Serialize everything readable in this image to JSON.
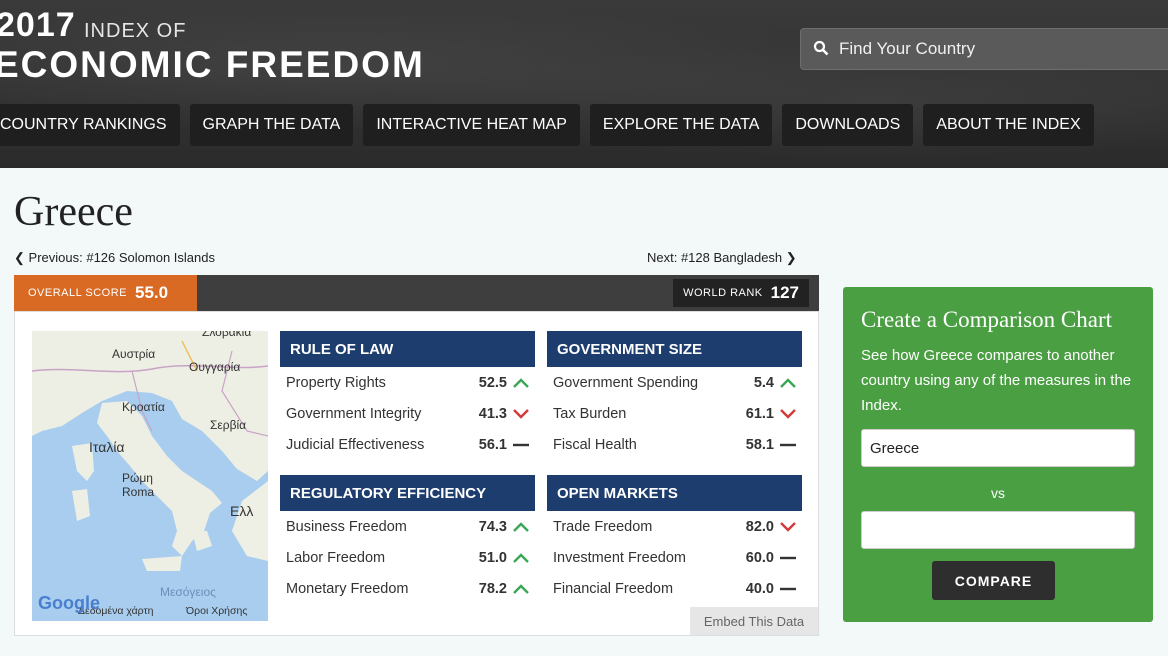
{
  "header": {
    "year": "2017",
    "index_of": "INDEX OF",
    "title": "ECONOMIC FREEDOM",
    "search_placeholder": "Find Your Country"
  },
  "nav": [
    {
      "label": "COUNTRY RANKINGS"
    },
    {
      "label": "GRAPH THE DATA"
    },
    {
      "label": "INTERACTIVE HEAT MAP"
    },
    {
      "label": "EXPLORE THE DATA"
    },
    {
      "label": "DOWNLOADS"
    },
    {
      "label": "ABOUT THE INDEX"
    }
  ],
  "country": {
    "name": "Greece",
    "previous": "Previous: #126 Solomon Islands",
    "next": "Next: #128 Bangladesh",
    "overall_label": "OVERALL SCORE",
    "overall_score": "55.0",
    "rank_label": "WORLD RANK",
    "rank": "127"
  },
  "map": {
    "labels": [
      "Ζλοβακία",
      "Αυστρία",
      "Ουγγαρία",
      "Κροατία",
      "Σερβία",
      "Ιταλία",
      "Ρώμη",
      "Roma",
      "Ελλ",
      "Μεσόγειος",
      "Δεδομένα χάρτη",
      "Όροι Χρήσης",
      "Google"
    ]
  },
  "categories": [
    {
      "title": "RULE OF LAW",
      "items": [
        {
          "name": "Property Rights",
          "value": "52.5",
          "trend": "up"
        },
        {
          "name": "Government Integrity",
          "value": "41.3",
          "trend": "down"
        },
        {
          "name": "Judicial Effectiveness",
          "value": "56.1",
          "trend": "flat"
        }
      ]
    },
    {
      "title": "GOVERNMENT SIZE",
      "items": [
        {
          "name": "Government Spending",
          "value": "5.4",
          "trend": "up"
        },
        {
          "name": "Tax Burden",
          "value": "61.1",
          "trend": "down"
        },
        {
          "name": "Fiscal Health",
          "value": "58.1",
          "trend": "flat"
        }
      ]
    },
    {
      "title": "REGULATORY EFFICIENCY",
      "items": [
        {
          "name": "Business Freedom",
          "value": "74.3",
          "trend": "up"
        },
        {
          "name": "Labor Freedom",
          "value": "51.0",
          "trend": "up"
        },
        {
          "name": "Monetary Freedom",
          "value": "78.2",
          "trend": "up"
        }
      ]
    },
    {
      "title": "OPEN MARKETS",
      "items": [
        {
          "name": "Trade Freedom",
          "value": "82.0",
          "trend": "down"
        },
        {
          "name": "Investment Freedom",
          "value": "60.0",
          "trend": "flat"
        },
        {
          "name": "Financial Freedom",
          "value": "40.0",
          "trend": "flat"
        }
      ]
    }
  ],
  "embed_label": "Embed This Data",
  "compare": {
    "title": "Create a Comparison Chart",
    "description": "See how Greece compares to another country using any of the measures in the Index.",
    "country1": "Greece",
    "vs": "vs",
    "country2": "",
    "button": "COMPARE"
  },
  "colors": {
    "trend_up": "#3aa655",
    "trend_down": "#d33a3a",
    "trend_flat": "#333333",
    "category_header": "#1d3d6e",
    "overall_orange": "#d96a24",
    "compare_green": "#4a9f43"
  }
}
